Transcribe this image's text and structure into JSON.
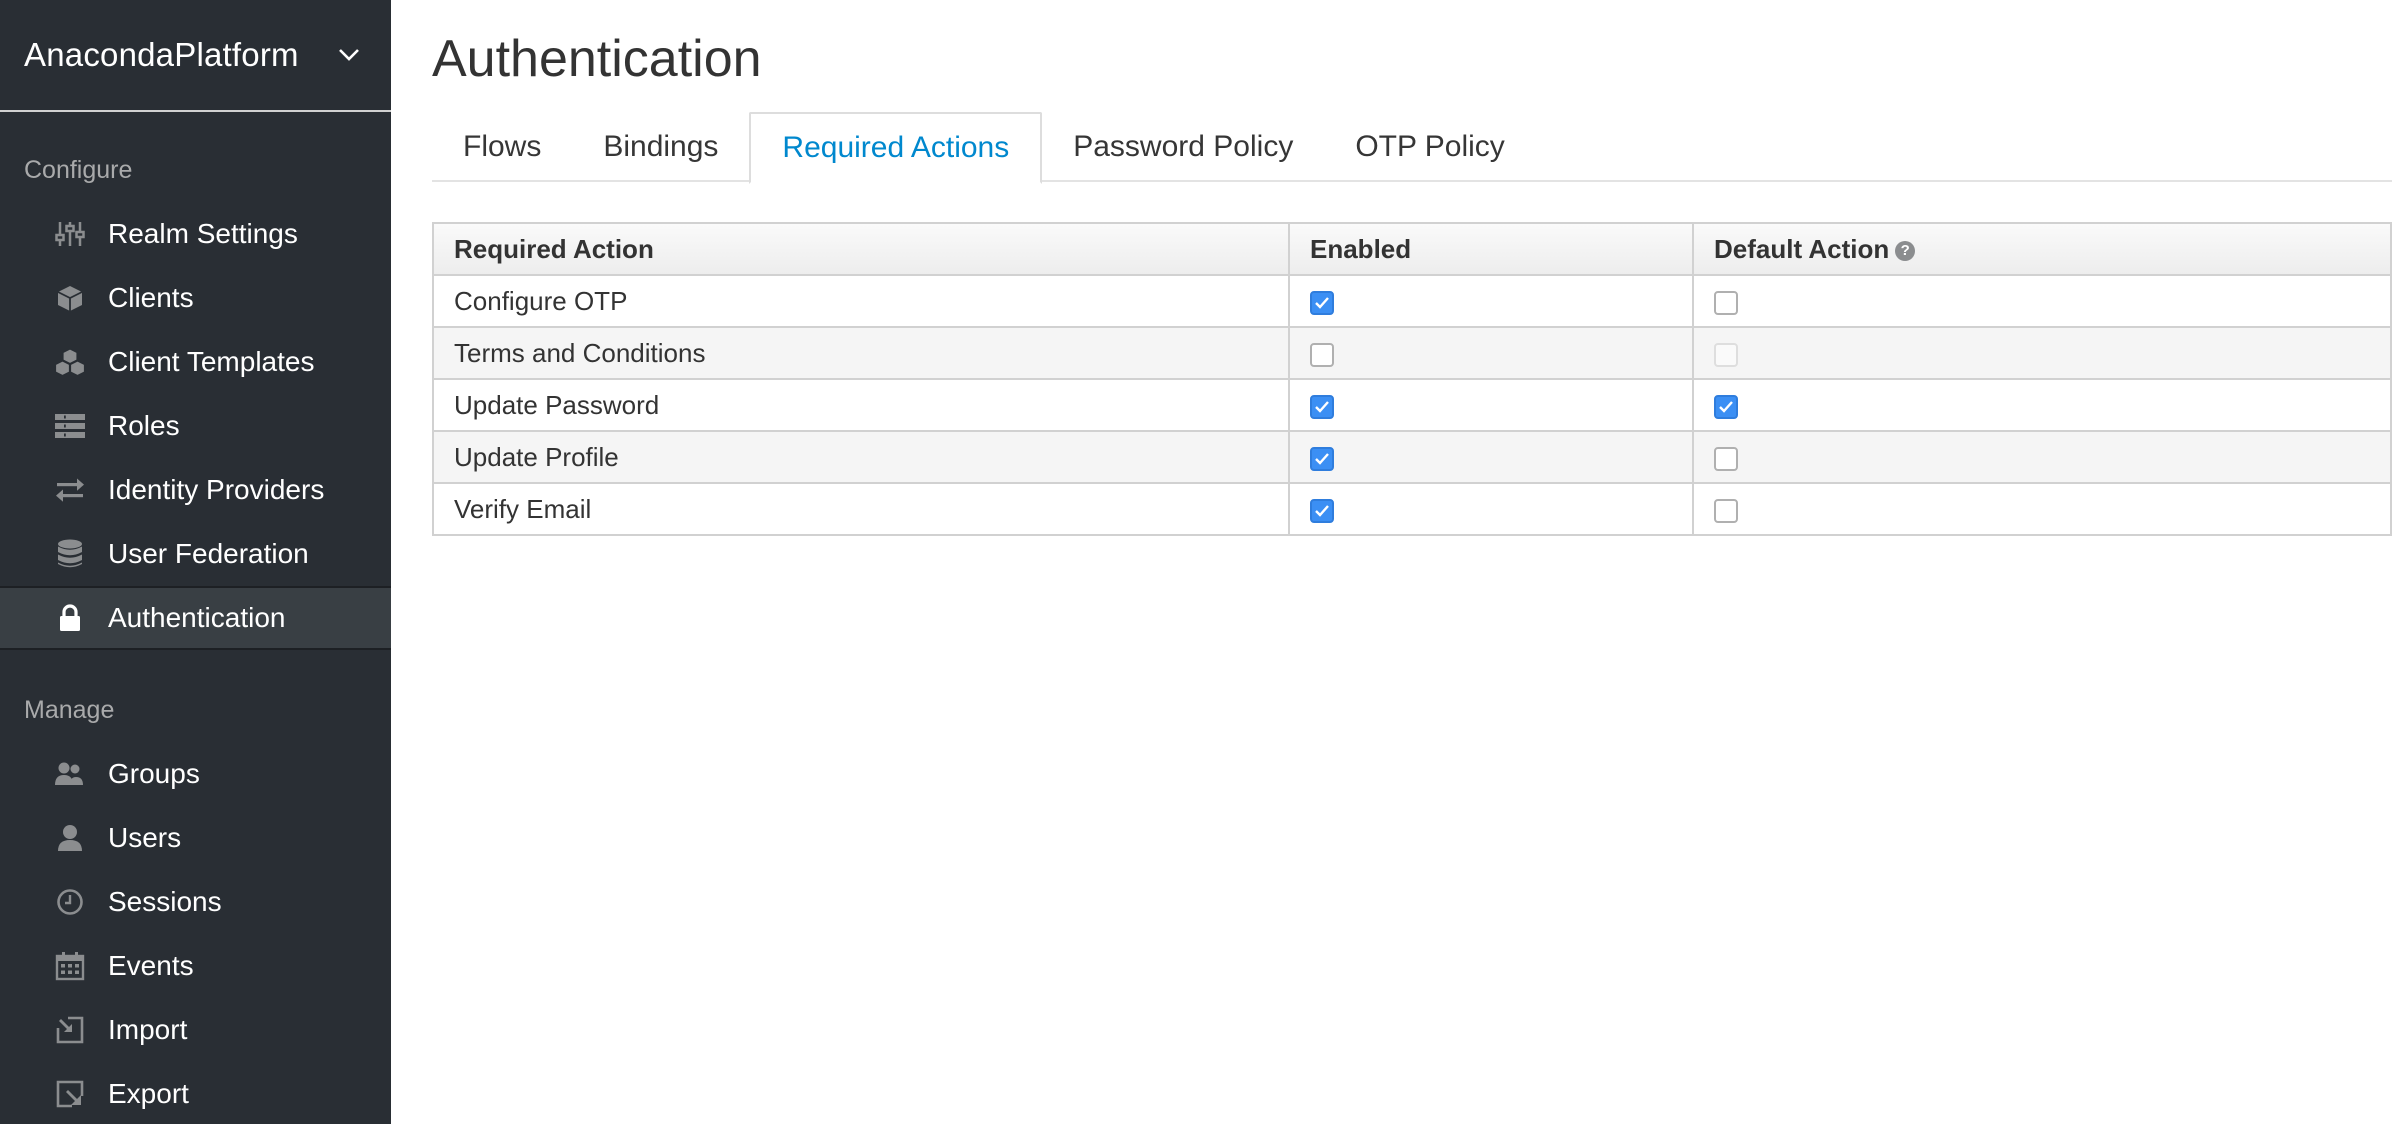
{
  "realm": {
    "name": "AnacondaPlatform"
  },
  "sidebar": {
    "configure_label": "Configure",
    "manage_label": "Manage",
    "configure_items": [
      {
        "label": "Realm Settings",
        "icon": "sliders-icon"
      },
      {
        "label": "Clients",
        "icon": "cube-icon"
      },
      {
        "label": "Client Templates",
        "icon": "cubes-icon"
      },
      {
        "label": "Roles",
        "icon": "list-icon"
      },
      {
        "label": "Identity Providers",
        "icon": "exchange-icon"
      },
      {
        "label": "User Federation",
        "icon": "database-icon"
      },
      {
        "label": "Authentication",
        "icon": "lock-icon",
        "active": true
      }
    ],
    "manage_items": [
      {
        "label": "Groups",
        "icon": "group-icon"
      },
      {
        "label": "Users",
        "icon": "user-icon"
      },
      {
        "label": "Sessions",
        "icon": "clock-icon"
      },
      {
        "label": "Events",
        "icon": "calendar-icon"
      },
      {
        "label": "Import",
        "icon": "import-icon"
      },
      {
        "label": "Export",
        "icon": "export-icon"
      }
    ]
  },
  "main": {
    "title": "Authentication",
    "tabs": [
      "Flows",
      "Bindings",
      "Required Actions",
      "Password Policy",
      "OTP Policy"
    ],
    "active_tab": "Required Actions",
    "table": {
      "headers": {
        "name": "Required Action",
        "enabled": "Enabled",
        "default": "Default Action"
      },
      "rows": [
        {
          "name": "Configure OTP",
          "enabled": true,
          "default": false,
          "default_disabled": false
        },
        {
          "name": "Terms and Conditions",
          "enabled": false,
          "default": false,
          "default_disabled": true
        },
        {
          "name": "Update Password",
          "enabled": true,
          "default": true,
          "default_disabled": false
        },
        {
          "name": "Update Profile",
          "enabled": true,
          "default": false,
          "default_disabled": false
        },
        {
          "name": "Verify Email",
          "enabled": true,
          "default": false,
          "default_disabled": false
        }
      ]
    }
  },
  "colors": {
    "sidebar_bg": "#292e34",
    "accent": "#0088ce",
    "checkbox_checked": "#3b8ff4"
  }
}
